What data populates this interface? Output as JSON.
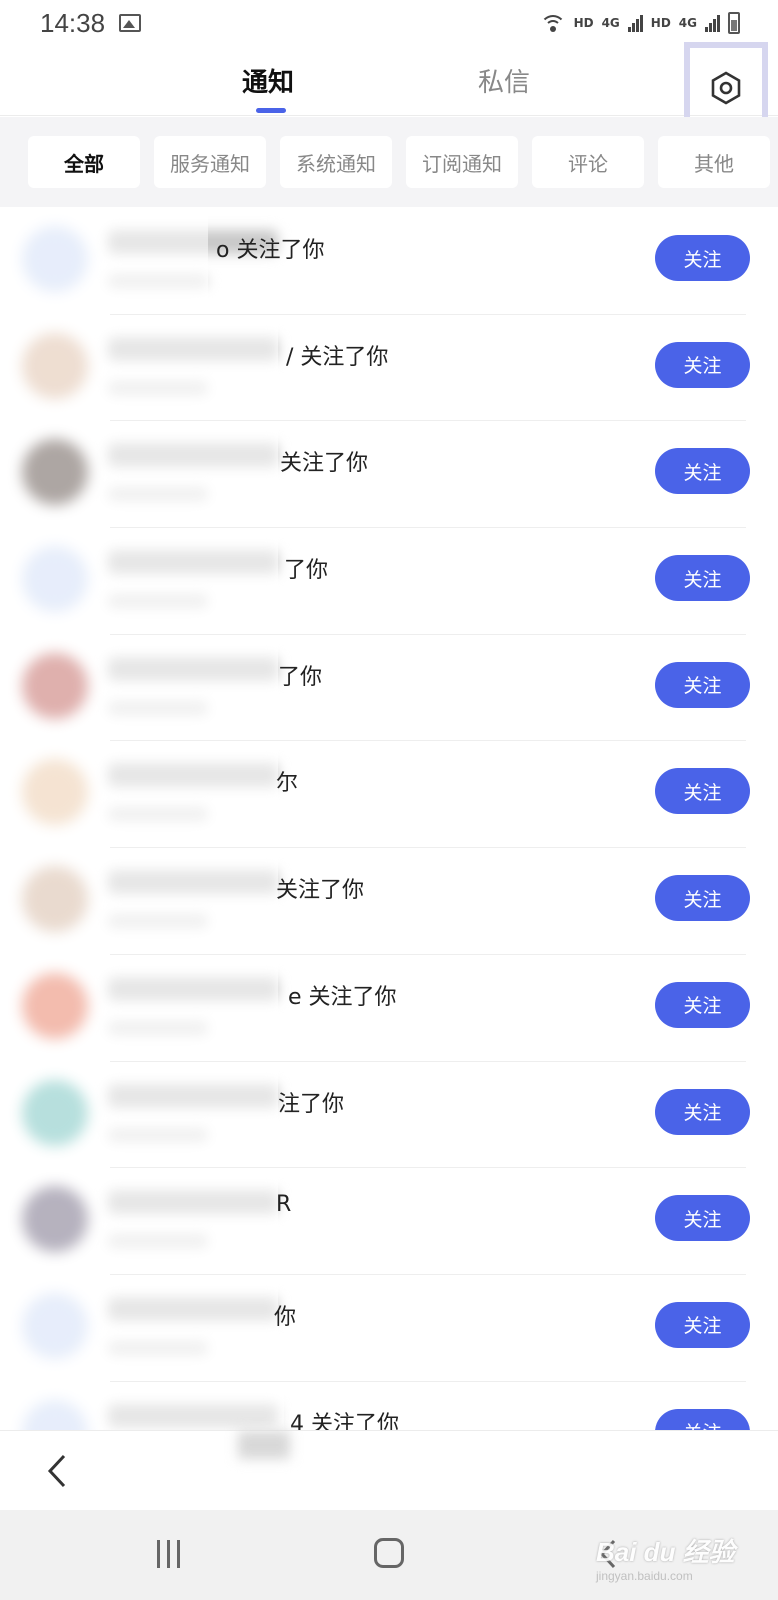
{
  "status_bar": {
    "time": "14:38",
    "network_label_1": "HD",
    "network_label_2": "4G",
    "network_label_3": "HD",
    "network_label_4": "4G"
  },
  "header": {
    "tabs": [
      {
        "label": "通知",
        "active": true
      },
      {
        "label": "私信",
        "active": false
      }
    ],
    "settings_icon": "settings-hexagon-icon",
    "accent_color": "#4a63e8"
  },
  "filters": [
    {
      "label": "全部",
      "active": true
    },
    {
      "label": "服务通知",
      "active": false
    },
    {
      "label": "系统通知",
      "active": false
    },
    {
      "label": "订阅通知",
      "active": false
    },
    {
      "label": "评论",
      "active": false
    },
    {
      "label": "其他",
      "active": false
    }
  ],
  "notifications": [
    {
      "message": "o 关注了你",
      "button": "关注",
      "avatar_color": "#c9d8f5"
    },
    {
      "message": "/ 关注了你",
      "button": "关注",
      "avatar_color": "#d9b59a"
    },
    {
      "message": "关注了你",
      "button": "关注",
      "avatar_color": "#4a3a33"
    },
    {
      "message": "了你",
      "button": "关注",
      "avatar_color": "#c9d8f5"
    },
    {
      "message": "了你",
      "button": "关注",
      "avatar_color": "#b8504a"
    },
    {
      "message": "尔",
      "button": "关注",
      "avatar_color": "#e8c29c"
    },
    {
      "message": "关注了你",
      "button": "关注",
      "avatar_color": "#cfae95"
    },
    {
      "message": "e 关注了你",
      "button": "关注",
      "avatar_color": "#e46a4c"
    },
    {
      "message": "注了你",
      "button": "关注",
      "avatar_color": "#5fb9b4"
    },
    {
      "message": "R",
      "button": "关注",
      "avatar_color": "#5d5470"
    },
    {
      "message": "你",
      "button": "关注",
      "avatar_color": "#c9d8f5"
    },
    {
      "message": "4 关注了你",
      "button": "关注",
      "avatar_color": "#c9d8f5"
    }
  ],
  "watermark": {
    "brand": "Bai du 经验",
    "url": "jingyan.baidu.com"
  }
}
